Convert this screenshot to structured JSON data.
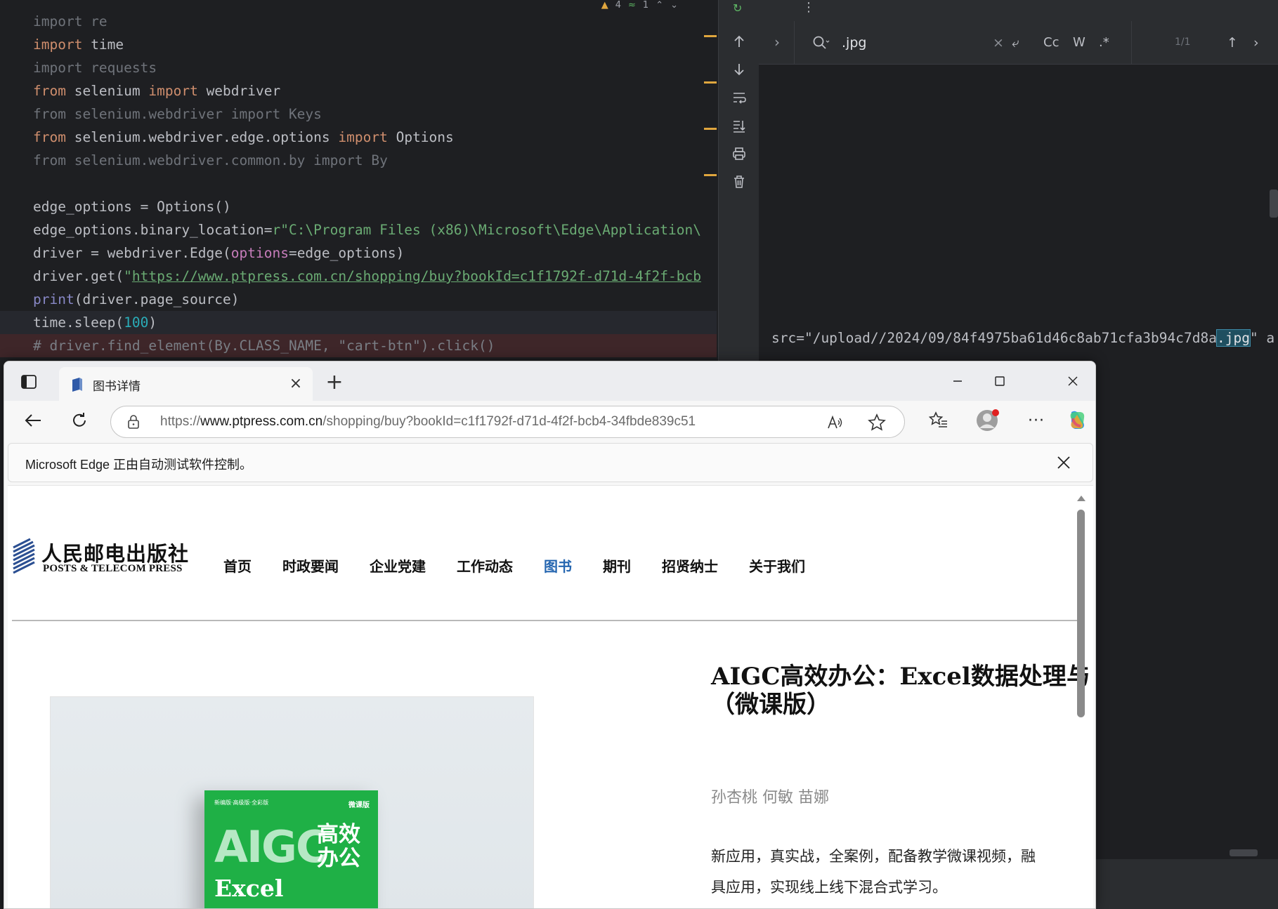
{
  "ide": {
    "status": {
      "warnings": "4",
      "weak_warnings": "1"
    },
    "code_lines": [
      [
        {
          "t": "import re",
          "c": "dim"
        }
      ],
      [
        {
          "t": "import",
          "c": "kw"
        },
        {
          "t": " time",
          "c": "def"
        }
      ],
      [
        {
          "t": "import requests",
          "c": "dim"
        }
      ],
      [
        {
          "t": "from",
          "c": "kw"
        },
        {
          "t": " selenium ",
          "c": "def"
        },
        {
          "t": "import",
          "c": "kw"
        },
        {
          "t": " webdriver",
          "c": "def"
        }
      ],
      [
        {
          "t": "from selenium.webdriver import Keys",
          "c": "dim"
        }
      ],
      [
        {
          "t": "from",
          "c": "kw"
        },
        {
          "t": " selenium.webdriver.edge.options ",
          "c": "def"
        },
        {
          "t": "import",
          "c": "kw"
        },
        {
          "t": " Options",
          "c": "def"
        }
      ],
      [
        {
          "t": "from selenium.webdriver.common.by import By",
          "c": "dim"
        }
      ],
      [
        {
          "t": "",
          "c": "def"
        }
      ],
      [
        {
          "t": "edge_options = Options()",
          "c": "def"
        }
      ],
      [
        {
          "t": "edge_options.binary_location=",
          "c": "def"
        },
        {
          "t": "r\"C:\\Program Files (x86)\\Microsoft\\Edge\\Application\\",
          "c": "str"
        }
      ],
      [
        {
          "t": "driver = webdriver.Edge(",
          "c": "def"
        },
        {
          "t": "options",
          "c": "param"
        },
        {
          "t": "=edge_options)",
          "c": "def"
        }
      ],
      [
        {
          "t": "driver.get(",
          "c": "def"
        },
        {
          "t": "\"",
          "c": "str"
        },
        {
          "t": "https://www.ptpress.com.cn/shopping/buy?bookId=c1f1792f-d71d-4f2f-bcb",
          "c": "url"
        }
      ],
      [
        {
          "t": "print",
          "c": "builtin"
        },
        {
          "t": "(driver.page_source)",
          "c": "def"
        }
      ],
      [
        {
          "t": "time.sleep(",
          "c": "def"
        },
        {
          "t": "100",
          "c": "num"
        },
        {
          "t": ")",
          "c": "def"
        }
      ],
      [
        {
          "t": "# driver.find_element(By.CLASS_NAME, \"cart-btn\").click()",
          "c": "cmt"
        }
      ]
    ]
  },
  "console": {
    "find": {
      "query": ".jpg",
      "match_case_label": "Cc",
      "words_label": "W",
      "regex_label": ".*",
      "count": "1/1"
    },
    "output_before": "src=\"/upload//2024/09/84f4975ba61d46c8ab71cfa3b94c7d8a",
    "output_match": ".jpg",
    "output_after": "\" a"
  },
  "edge": {
    "tab_title": "图书详情",
    "url_prefix": "https://",
    "url_host": "www.ptpress.com.cn",
    "url_path": "/shopping/buy?bookId=c1f1792f-d71d-4f2f-bcb4-34fbde839c51",
    "infobar_message": "Microsoft Edge 正由自动测试软件控制。",
    "site": {
      "logo_cn": "人民邮电出版社",
      "logo_en": "POSTS & TELECOM PRESS",
      "nav": [
        {
          "label": "首页"
        },
        {
          "label": "时政要闻"
        },
        {
          "label": "企业党建"
        },
        {
          "label": "工作动态"
        },
        {
          "label": "图书",
          "active": true
        },
        {
          "label": "期刊"
        },
        {
          "label": "招贤纳士"
        },
        {
          "label": "关于我们"
        }
      ],
      "book": {
        "title_line1": "AIGC高效办公：Excel数据处理与",
        "title_line2": "（微课版）",
        "authors": "孙杏桃 何敏 苗娜",
        "desc_line1": "新应用，真实战，全案例，配备教学微课视频，融",
        "desc_line2": "具应用，实现线上线下混合式学习。",
        "cover": {
          "tiny_text": "新编版·高级版·全彩版",
          "badge": "微课版",
          "big_text": "AIGC",
          "side_text": "高效办公",
          "sub_text": "Excel"
        }
      }
    }
  }
}
